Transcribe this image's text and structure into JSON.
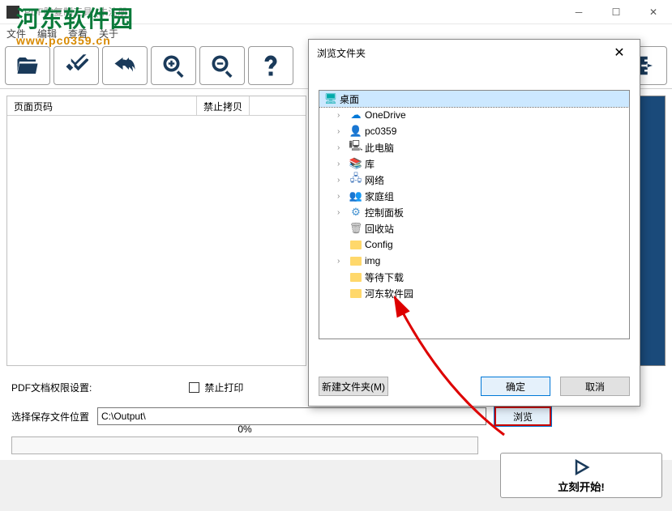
{
  "window": {
    "title": "PDF防复制工具 (未注册)"
  },
  "menu": {
    "file": "文件",
    "edit": "编辑",
    "view": "查看",
    "about": "关于"
  },
  "watermark": {
    "cn": "河东软件园",
    "en": "www.pc0359.cn"
  },
  "table": {
    "col1": "页面页码",
    "col2": "禁止拷贝"
  },
  "options": {
    "rights_label": "PDF文档权限设置:",
    "noprint_label": "禁止打印"
  },
  "output": {
    "label": "选择保存文件位置",
    "path": "C:\\Output\\",
    "browse": "浏览"
  },
  "progress": {
    "percent": "0%"
  },
  "start_label": "立刻开始!",
  "dialog": {
    "title": "浏览文件夹",
    "new_folder": "新建文件夹(M)",
    "ok": "确定",
    "cancel": "取消",
    "tree": {
      "desktop": "桌面",
      "onedrive": "OneDrive",
      "user": "pc0359",
      "thispc": "此电脑",
      "libraries": "库",
      "network": "网络",
      "homegroup": "家庭组",
      "controlpanel": "控制面板",
      "recyclebin": "回收站",
      "config": "Config",
      "img": "img",
      "pending": "等待下载",
      "hdrj": "河东软件园"
    }
  }
}
